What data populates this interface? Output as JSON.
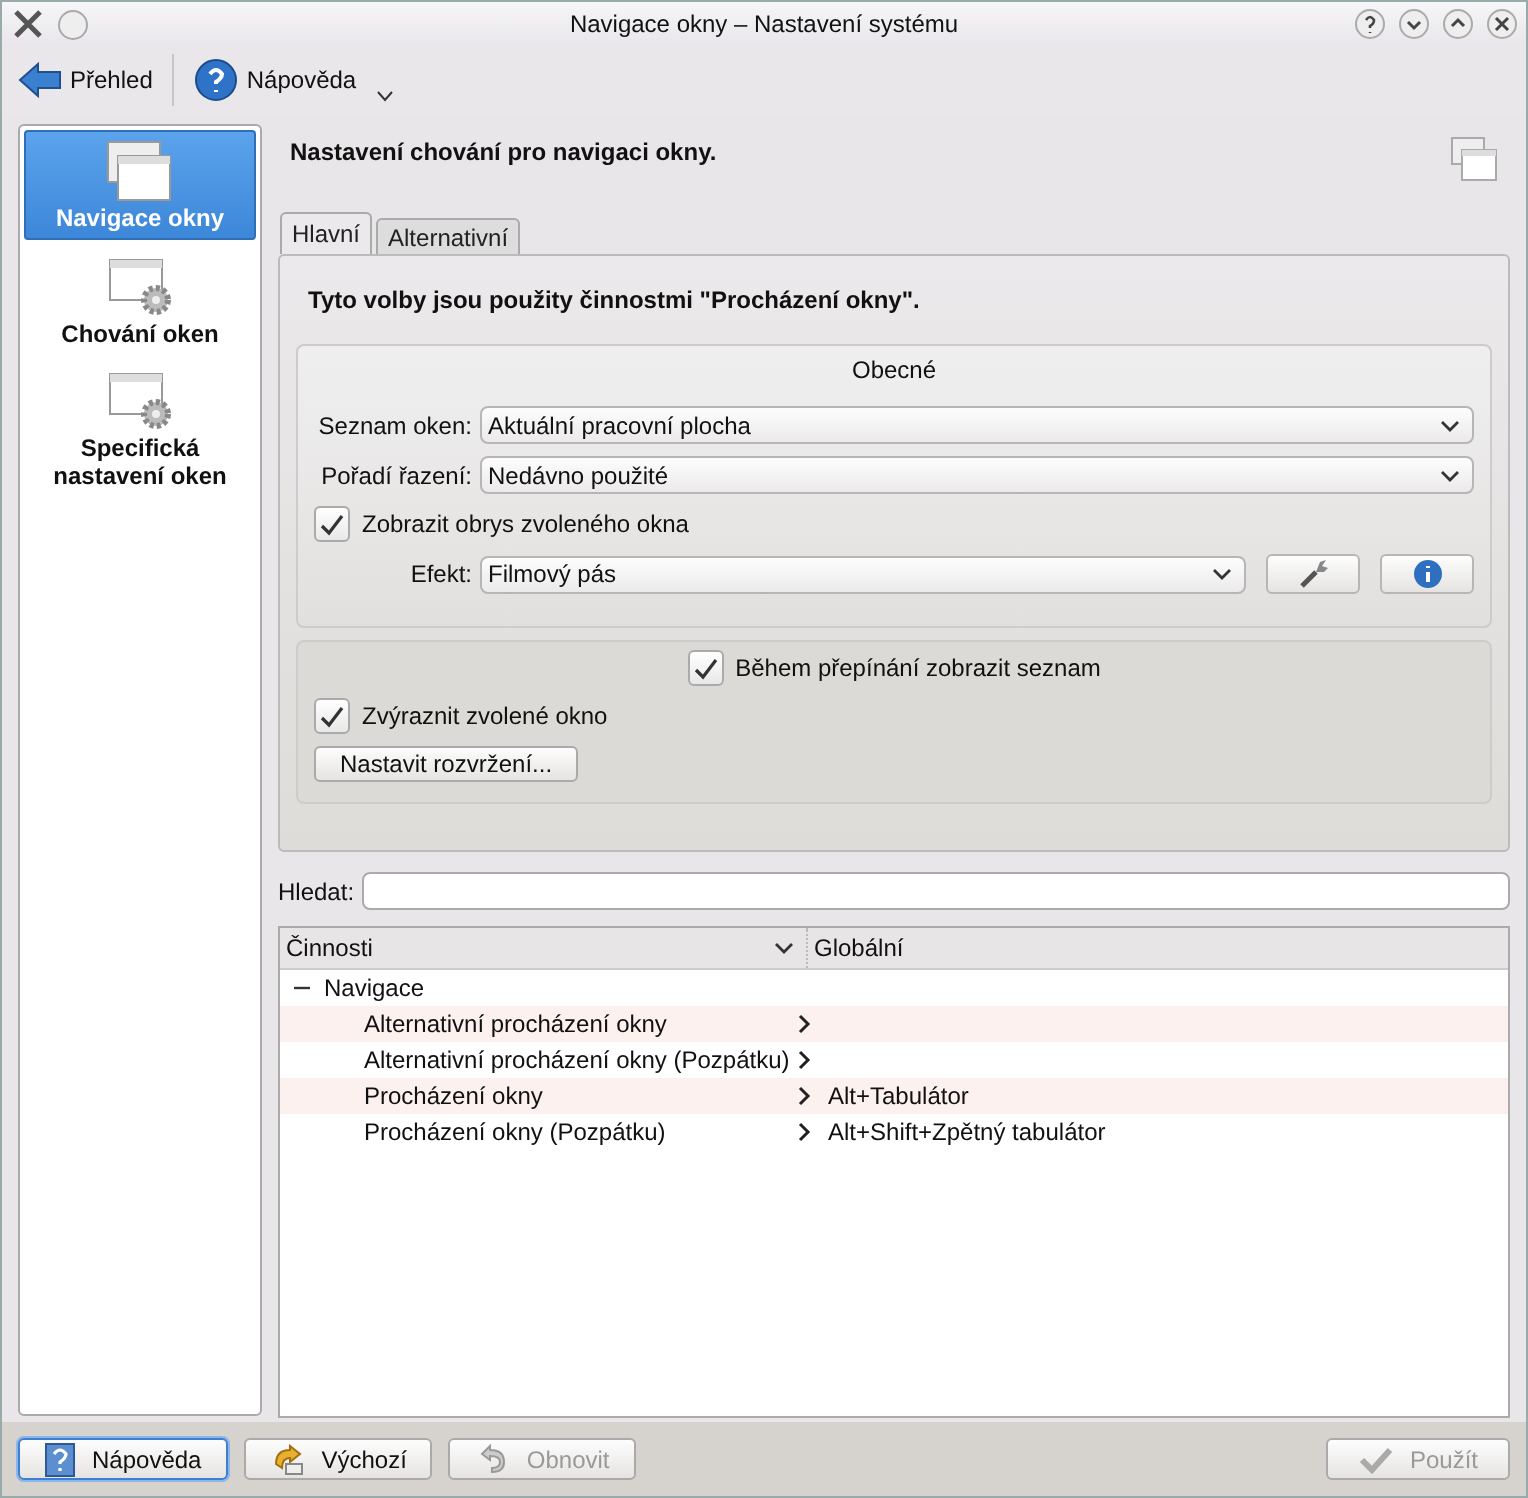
{
  "window": {
    "title": "Navigace okny – Nastavení systému"
  },
  "toolbar": [
    {
      "label": "Přehled",
      "kind": "back"
    },
    {
      "label": "Nápověda",
      "kind": "help"
    }
  ],
  "sidebar": {
    "items": [
      {
        "label": "Navigace okny",
        "selected": true,
        "kind": "windows"
      },
      {
        "label": "Chování oken",
        "selected": false,
        "kind": "gear"
      },
      {
        "label": "Specifická nastavení oken",
        "selected": false,
        "kind": "gear"
      }
    ]
  },
  "header": "Nastavení chování pro navigaci okny.",
  "tabs": [
    {
      "label": "Hlavní",
      "selected": true
    },
    {
      "label": "Alternativní",
      "selected": false
    }
  ],
  "intro": "Tyto volby jsou použity činnostmi \"Procházení okny\".",
  "general": {
    "title": "Obecné",
    "window_list": {
      "label": "Seznam oken:",
      "value": "Aktuální pracovní plocha"
    },
    "sort_order": {
      "label": "Pořadí řazení:",
      "value": "Nedávno použité"
    },
    "show_outline": {
      "label": "Zobrazit obrys zvoleného okna",
      "checked": true
    },
    "effect": {
      "label": "Efekt:",
      "value": "Filmový pás"
    }
  },
  "list_group": {
    "show_list": {
      "label": "Během přepínání zobrazit seznam",
      "checked": true
    },
    "highlight": {
      "label": "Zvýraznit zvolené okno",
      "checked": true
    },
    "layout_button": "Nastavit rozvržení..."
  },
  "search": {
    "label": "Hledat:"
  },
  "shortcuts": {
    "columns": [
      "Činnosti",
      "Globální"
    ],
    "rows": [
      {
        "label": "Navigace",
        "expanded": true,
        "children": [
          {
            "label": "Alternativní procházení okny"
          },
          {
            "label": "Alternativní procházení okny (Pozpátku)"
          },
          {
            "label": "Procházení okny",
            "shortcut": "Alt+Tabulátor"
          },
          {
            "label": "Procházení okny (Pozpátku)",
            "shortcut": "Alt+Shift+Zpětný tabulátor"
          }
        ]
      }
    ]
  },
  "buttons": [
    {
      "label": "Nápověda",
      "kind": "help",
      "disabled": false,
      "focused": true
    },
    {
      "label": "Výchozí",
      "kind": "defaults",
      "disabled": false,
      "focused": false
    },
    {
      "label": "Obnovit",
      "kind": "reset",
      "disabled": true,
      "focused": false
    },
    {
      "label": "Použít",
      "kind": "apply",
      "disabled": true,
      "focused": false
    }
  ]
}
